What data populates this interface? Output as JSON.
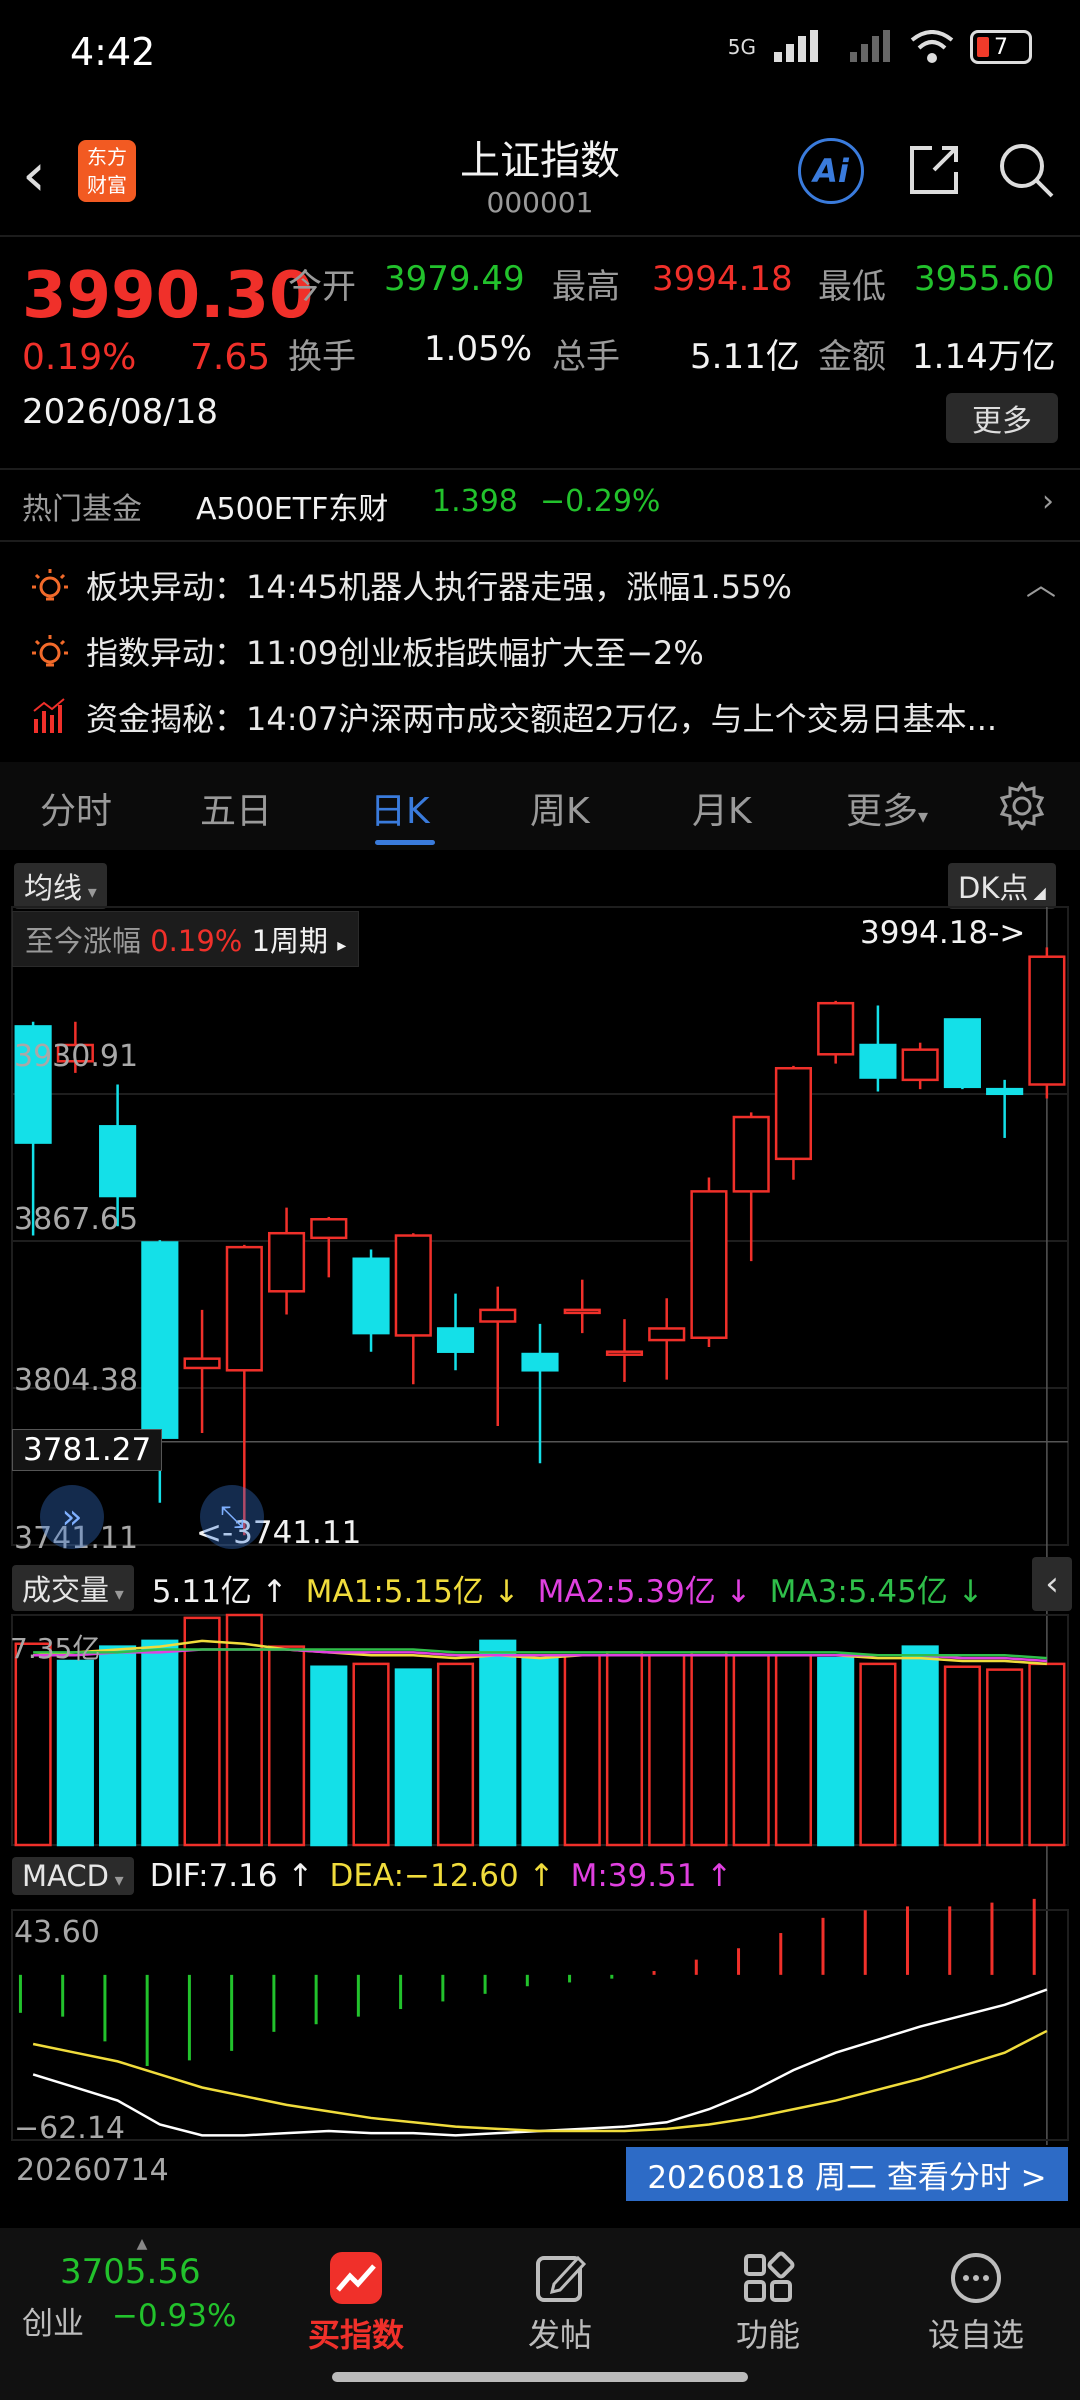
{
  "status_bar": {
    "time": "4:42",
    "network": "5G",
    "battery": "7"
  },
  "header": {
    "logo_text_line1": "东方",
    "logo_text_line2": "财富",
    "title": "上证指数",
    "code": "000001",
    "ai_label": "Ai"
  },
  "quote": {
    "price": "3990.30",
    "pct": "0.19%",
    "change": "7.65",
    "date": "2026/08/18",
    "open_label": "今开",
    "open": "3979.49",
    "high_label": "最高",
    "high": "3994.18",
    "low_label": "最低",
    "low": "3955.60",
    "turnover_label": "换手",
    "turnover": "1.05%",
    "volume_label": "总手",
    "volume": "5.11亿",
    "amount_label": "金额",
    "amount": "1.14万亿",
    "more_label": "更多"
  },
  "hot_fund": {
    "label": "热门基金",
    "name": "A500ETF东财",
    "price": "1.398",
    "pct": "−0.29%"
  },
  "news": [
    {
      "icon": "bulb-icon",
      "text": "板块异动：14:45机器人执行器走强，涨幅1.55%"
    },
    {
      "icon": "bulb-icon",
      "text": "指数异动：11:09创业板指跌幅扩大至−2%"
    },
    {
      "icon": "bar-chart-icon",
      "text": "资金揭秘：14:07沪深两市成交额超2万亿，与上个交易日基本..."
    }
  ],
  "tabs": [
    "分时",
    "五日",
    "日K",
    "周K",
    "月K",
    "更多"
  ],
  "chart": {
    "ma_pill": "均线",
    "dk_pill": "DK点",
    "since_label": "至今涨幅",
    "since_pct": "0.19%",
    "period": "1周期",
    "high_marker": "3994.18->",
    "low_marker": "<-3741.11",
    "crosshair_price": "3781.27",
    "y_labels": [
      "3930.91",
      "3867.65",
      "3804.38",
      "3741.11"
    ],
    "volume": {
      "pill": "成交量",
      "value": "5.11亿",
      "ma1": "MA1:5.15亿",
      "ma2": "MA2:5.39亿",
      "ma3": "MA3:5.45亿",
      "max_label": "7.35亿"
    },
    "macd": {
      "pill": "MACD",
      "dif": "DIF:7.16",
      "dea": "DEA:−12.60",
      "m": "M:39.51",
      "max_label": "43.60",
      "min_label": "−62.14"
    },
    "start_date": "20260714",
    "end_button": "20260818 周二 查看分时 >"
  },
  "chart_data": {
    "type": "candlestick",
    "ylim": [
      3741.11,
      3994.18
    ],
    "candles": [
      {
        "o": 3960,
        "c": 3910,
        "h": 3962,
        "l": 3870
      },
      {
        "o": 3945,
        "c": 3952,
        "h": 3962,
        "l": 3940
      },
      {
        "o": 3917,
        "c": 3887,
        "h": 3935,
        "l": 3874
      },
      {
        "o": 3867,
        "c": 3783,
        "h": 3868,
        "l": 3755
      },
      {
        "o": 3813,
        "c": 3817,
        "h": 3838,
        "l": 3785
      },
      {
        "o": 3812,
        "c": 3865,
        "h": 3866,
        "l": 3741
      },
      {
        "o": 3846,
        "c": 3871,
        "h": 3882,
        "l": 3836
      },
      {
        "o": 3869,
        "c": 3877,
        "h": 3878,
        "l": 3852
      },
      {
        "o": 3860,
        "c": 3828,
        "h": 3864,
        "l": 3820
      },
      {
        "o": 3827,
        "c": 3870,
        "h": 3871,
        "l": 3806
      },
      {
        "o": 3830,
        "c": 3820,
        "h": 3845,
        "l": 3812
      },
      {
        "o": 3833,
        "c": 3838,
        "h": 3848,
        "l": 3788
      },
      {
        "o": 3819,
        "c": 3812,
        "h": 3832,
        "l": 3772
      },
      {
        "o": 3838,
        "c": 3838,
        "h": 3851,
        "l": 3828
      },
      {
        "o": 3820,
        "c": 3820,
        "h": 3834,
        "l": 3807
      },
      {
        "o": 3825,
        "c": 3830,
        "h": 3843,
        "l": 3808
      },
      {
        "o": 3826,
        "c": 3889,
        "h": 3895,
        "l": 3822
      },
      {
        "o": 3889,
        "c": 3921,
        "h": 3923,
        "l": 3859
      },
      {
        "o": 3903,
        "c": 3942,
        "h": 3943,
        "l": 3894
      },
      {
        "o": 3948,
        "c": 3970,
        "h": 3971,
        "l": 3944
      },
      {
        "o": 3952,
        "c": 3938,
        "h": 3969,
        "l": 3932
      },
      {
        "o": 3937,
        "c": 3950,
        "h": 3953,
        "l": 3933
      },
      {
        "o": 3963,
        "c": 3934,
        "h": 3963,
        "l": 3933
      },
      {
        "o": 3933,
        "c": 3931,
        "h": 3937,
        "l": 3912
      },
      {
        "o": 3935,
        "c": 3990,
        "h": 3994,
        "l": 3929
      }
    ],
    "volumes": [
      {
        "v": 7.0,
        "dir": "up"
      },
      {
        "v": 6.4,
        "dir": "down"
      },
      {
        "v": 6.9,
        "dir": "down"
      },
      {
        "v": 7.1,
        "dir": "down"
      },
      {
        "v": 7.9,
        "dir": "up"
      },
      {
        "v": 8.0,
        "dir": "up"
      },
      {
        "v": 6.9,
        "dir": "up"
      },
      {
        "v": 6.2,
        "dir": "down"
      },
      {
        "v": 6.3,
        "dir": "up"
      },
      {
        "v": 6.1,
        "dir": "down"
      },
      {
        "v": 6.3,
        "dir": "up"
      },
      {
        "v": 7.1,
        "dir": "down"
      },
      {
        "v": 6.5,
        "dir": "down"
      },
      {
        "v": 6.6,
        "dir": "up"
      },
      {
        "v": 6.7,
        "dir": "up"
      },
      {
        "v": 6.6,
        "dir": "up"
      },
      {
        "v": 6.7,
        "dir": "up"
      },
      {
        "v": 6.6,
        "dir": "up"
      },
      {
        "v": 6.6,
        "dir": "up"
      },
      {
        "v": 6.5,
        "dir": "down"
      },
      {
        "v": 6.3,
        "dir": "up"
      },
      {
        "v": 6.9,
        "dir": "down"
      },
      {
        "v": 6.2,
        "dir": "up"
      },
      {
        "v": 6.1,
        "dir": "up"
      },
      {
        "v": 6.3,
        "dir": "up"
      }
    ],
    "volume_ylim": [
      0,
      8.0
    ],
    "ma1": [
      6.6,
      6.7,
      6.8,
      6.9,
      7.1,
      7.0,
      6.8,
      6.7,
      6.6,
      6.6,
      6.5,
      6.6,
      6.5,
      6.6,
      6.6,
      6.6,
      6.6,
      6.6,
      6.6,
      6.6,
      6.5,
      6.5,
      6.4,
      6.4,
      6.3
    ],
    "ma2": [
      6.6,
      6.6,
      6.7,
      6.7,
      6.8,
      6.8,
      6.8,
      6.7,
      6.7,
      6.7,
      6.6,
      6.6,
      6.6,
      6.6,
      6.6,
      6.6,
      6.6,
      6.6,
      6.6,
      6.6,
      6.6,
      6.6,
      6.5,
      6.5,
      6.4
    ],
    "ma3": [
      6.7,
      6.7,
      6.7,
      6.8,
      6.8,
      6.8,
      6.8,
      6.8,
      6.8,
      6.8,
      6.7,
      6.7,
      6.7,
      6.7,
      6.7,
      6.7,
      6.7,
      6.7,
      6.7,
      6.7,
      6.6,
      6.6,
      6.6,
      6.6,
      6.5
    ],
    "macd_hist": [
      -20,
      -22,
      -35,
      -48,
      -45,
      -40,
      -30,
      -26,
      -22,
      -18,
      -14,
      -10,
      -6,
      -4,
      -2,
      2,
      8,
      14,
      22,
      30,
      34,
      36,
      36,
      38,
      40
    ],
    "macd_dif": [
      -32,
      -38,
      -44,
      -55,
      -60,
      -60,
      -59,
      -58,
      -59,
      -59,
      -60,
      -59,
      -58,
      -57,
      -56,
      -54,
      -48,
      -40,
      -30,
      -22,
      -16,
      -10,
      -5,
      0,
      7
    ],
    "macd_dea": [
      -18,
      -22,
      -26,
      -32,
      -38,
      -42,
      -46,
      -49,
      -52,
      -54,
      -56,
      -57,
      -58,
      -58,
      -58,
      -57,
      -55,
      -52,
      -48,
      -44,
      -39,
      -34,
      -28,
      -22,
      -12
    ],
    "macd_ylim": [
      -62.14,
      43.6
    ]
  },
  "bottom_nav": {
    "index_value": "3705.56",
    "index_name": "创业",
    "index_pct": "−0.93%",
    "items": [
      "买指数",
      "发帖",
      "功能",
      "设自选"
    ]
  },
  "colors": {
    "up": "#f0302a",
    "down": "#14e0e8",
    "accent": "#3a7bdc"
  }
}
